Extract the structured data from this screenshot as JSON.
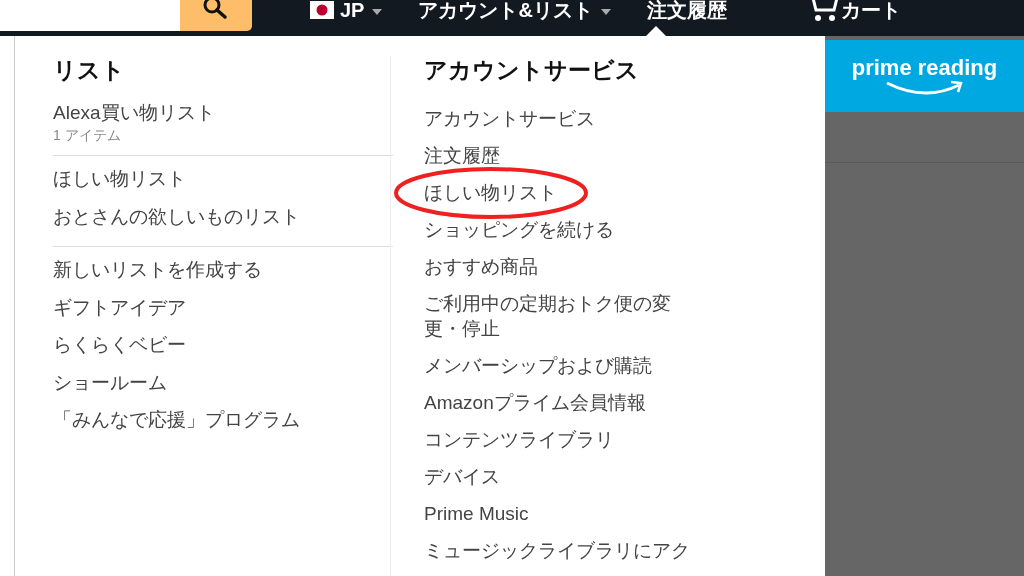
{
  "nav": {
    "language": "JP",
    "account": "アカウント&リスト",
    "orders": "注文履歴",
    "cart": "カート"
  },
  "lists_column": {
    "title": "リスト",
    "groups": [
      {
        "items": [
          {
            "label": "Alexa買い物リスト",
            "sub": "1 アイテム"
          }
        ]
      },
      {
        "items": [
          {
            "label": "ほしい物リスト"
          },
          {
            "label": "おとさんの欲しいものリスト"
          }
        ]
      },
      {
        "items": [
          {
            "label": "新しいリストを作成する"
          },
          {
            "label": "ギフトアイデア"
          },
          {
            "label": "らくらくベビー"
          },
          {
            "label": "ショールーム"
          },
          {
            "label": "「みんなで応援」プログラム"
          }
        ]
      }
    ]
  },
  "account_column": {
    "title": "アカウントサービス",
    "items": [
      {
        "label": "アカウントサービス",
        "circled": false
      },
      {
        "label": "注文履歴",
        "circled": false
      },
      {
        "label": "ほしい物リスト",
        "circled": true
      },
      {
        "label": "ショッピングを続ける",
        "circled": false
      },
      {
        "label": "おすすめ商品",
        "circled": false
      },
      {
        "label": "ご利用中の定期おトク便の変更・停止",
        "circled": false
      },
      {
        "label": "メンバーシップおよび購読",
        "circled": false
      },
      {
        "label": "Amazonプライム会員情報",
        "circled": false
      },
      {
        "label": "コンテンツライブラリ",
        "circled": false
      },
      {
        "label": "デバイス",
        "circled": false
      },
      {
        "label": "Prime Music",
        "circled": false
      },
      {
        "label": "ミュージックライブラリにアク",
        "circled": false
      }
    ]
  },
  "promo": {
    "logo": "prime reading"
  }
}
